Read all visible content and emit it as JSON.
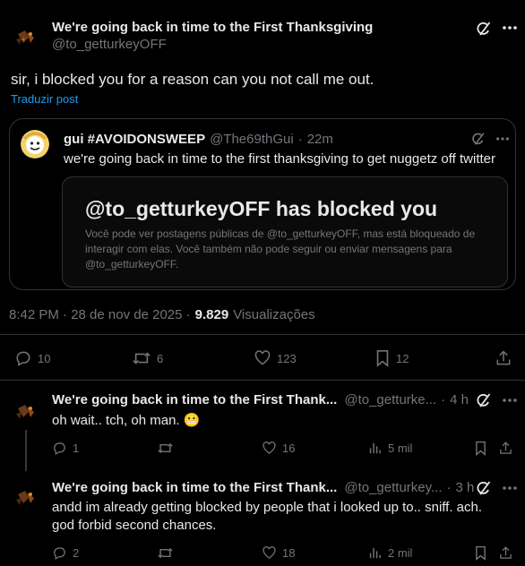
{
  "main_post": {
    "display_name": "We're going back in time to the First Thanksgiving",
    "handle": "@to_getturkeyOFF",
    "text": "sir, i blocked you for a reason can you not call me out.",
    "translate_label": "Traduzir post",
    "quote": {
      "display_name": "gui #AVOIDONSWEEP",
      "handle": "@The69thGui",
      "separator": "·",
      "time": "22m",
      "text": "we're going back in time to the first thanksgiving to get nuggetz off twitter",
      "blocked_card": {
        "title": "@to_getturkeyOFF has blocked you",
        "body": "Você pode ver postagens públicas de @to_getturkeyOFF, mas está bloqueado de interagir com elas. Você também não pode seguir ou enviar mensagens para @to_getturkeyOFF."
      }
    },
    "timestamp": "8:42 PM · 28 de nov de 2025 ·",
    "views_count": "9.829",
    "views_label": "Visualizações",
    "actions": {
      "replies": "10",
      "reposts": "6",
      "likes": "123",
      "bookmarks": "12"
    }
  },
  "replies": [
    {
      "display_name": "We're going back in time to the First Thank...",
      "handle": "@to_getturke...",
      "separator": "·",
      "time": "4 h",
      "text": "oh wait.. tch, oh man. 😬",
      "emoji": "😬",
      "actions": {
        "replies": "1",
        "reposts": "",
        "likes": "16",
        "views": "5 mil"
      }
    },
    {
      "display_name": "We're going back in time to the First Thank...",
      "handle": "@to_getturkey...",
      "separator": "·",
      "time": "3 h",
      "text_line1": "andd im already getting blocked by people that i looked up to.. sniff. ach.",
      "text_line2": "god forbid second chances.",
      "actions": {
        "replies": "2",
        "reposts": "",
        "likes": "18",
        "views": "2 mil"
      }
    }
  ],
  "colors": {
    "background": "#000000",
    "text": "#e7e9ea",
    "muted": "#71767b",
    "link": "#1d9bf0",
    "border": "#2f3336"
  }
}
